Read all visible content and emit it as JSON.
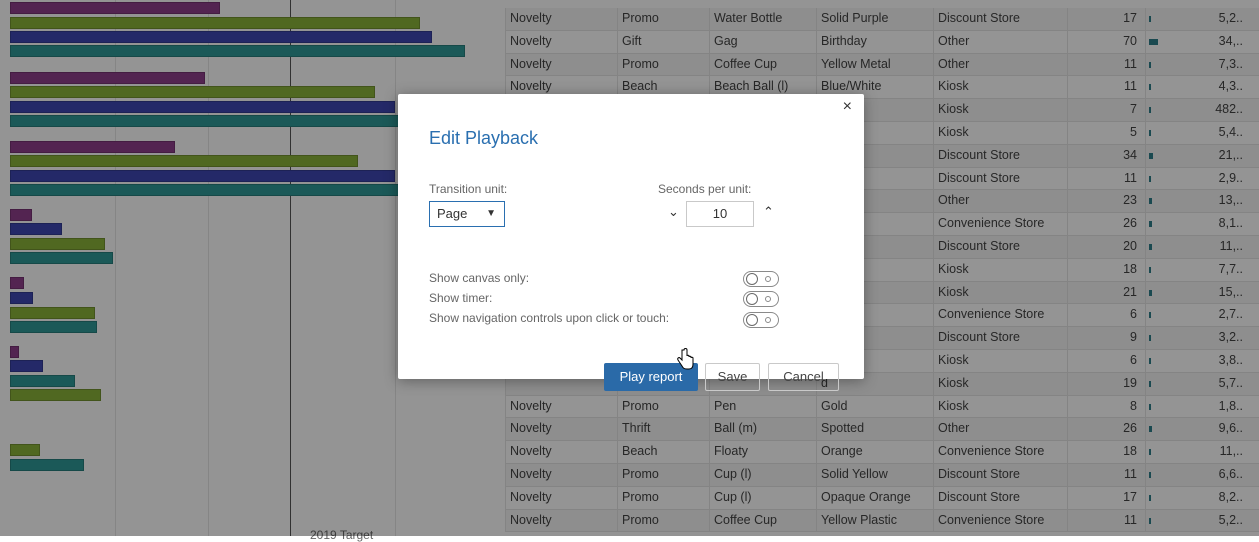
{
  "chart": {
    "caption": "2019 Target",
    "bars": [
      {
        "value": 210,
        "color": "#8f3f8c"
      },
      {
        "value": 410,
        "color": "#8bb33a"
      },
      {
        "value": 422,
        "color": "#3f48b4"
      },
      {
        "value": 455,
        "color": "#2f9a98"
      },
      {
        "value": 195,
        "color": "#8f3f8c"
      },
      {
        "value": 365,
        "color": "#8bb33a"
      },
      {
        "value": 385,
        "color": "#3f48b4"
      },
      {
        "value": 400,
        "color": "#2f9a98"
      },
      {
        "value": 165,
        "color": "#8f3f8c"
      },
      {
        "value": 348,
        "color": "#8bb33a"
      },
      {
        "value": 385,
        "color": "#3f48b4"
      },
      {
        "value": 400,
        "color": "#2f9a98"
      },
      {
        "value": 22,
        "color": "#8f3f8c"
      },
      {
        "value": 52,
        "color": "#3f48b4"
      },
      {
        "value": 95,
        "color": "#8bb33a"
      },
      {
        "value": 103,
        "color": "#2f9a98"
      },
      {
        "value": 14,
        "color": "#8f3f8c"
      },
      {
        "value": 23,
        "color": "#3f48b4"
      },
      {
        "value": 85,
        "color": "#8bb33a"
      },
      {
        "value": 87,
        "color": "#2f9a98"
      },
      {
        "value": 9,
        "color": "#8f3f8c"
      },
      {
        "value": 33,
        "color": "#3f48b4"
      },
      {
        "value": 65,
        "color": "#2f9a98"
      },
      {
        "value": 91,
        "color": "#8bb33a"
      },
      {
        "value": 30,
        "color": "#8bb33a"
      },
      {
        "value": 74,
        "color": "#2f9a98"
      }
    ]
  },
  "table": {
    "rows": [
      {
        "cat": "Novelty",
        "sub": "Promo",
        "prod": "Water Bottle",
        "style": "Solid Purple",
        "chan": "Discount Store",
        "qty": "17",
        "sales": "5,2..",
        "spark": 17
      },
      {
        "cat": "Novelty",
        "sub": "Gift",
        "prod": "Gag",
        "style": "Birthday",
        "chan": "Other",
        "qty": "70",
        "sales": "34,..",
        "spark": 70
      },
      {
        "cat": "Novelty",
        "sub": "Promo",
        "prod": "Coffee Cup",
        "style": "Yellow Metal",
        "chan": "Other",
        "qty": "11",
        "sales": "7,3..",
        "spark": 11
      },
      {
        "cat": "Novelty",
        "sub": "Beach",
        "prod": "Beach Ball (l)",
        "style": "Blue/White",
        "chan": "Kiosk",
        "qty": "11",
        "sales": "4,3..",
        "spark": 11
      },
      {
        "cat": "",
        "sub": "",
        "prod": "",
        "style": "e",
        "chan": "Kiosk",
        "qty": "7",
        "sales": "482..",
        "spark": 7
      },
      {
        "cat": "",
        "sub": "",
        "prod": "",
        "style": "urple",
        "chan": "Kiosk",
        "qty": "5",
        "sales": "5,4..",
        "spark": 5
      },
      {
        "cat": "",
        "sub": "",
        "prod": "",
        "style": "",
        "chan": "Discount Store",
        "qty": "34",
        "sales": "21,..",
        "spark": 34
      },
      {
        "cat": "",
        "sub": "",
        "prod": "",
        "style": "Green",
        "chan": "Discount Store",
        "qty": "11",
        "sales": "2,9..",
        "spark": 11
      },
      {
        "cat": "",
        "sub": "",
        "prod": "",
        "style": "6",
        "chan": "Other",
        "qty": "23",
        "sales": "13,..",
        "spark": 23
      },
      {
        "cat": "",
        "sub": "",
        "prod": "",
        "style": "",
        "chan": "Convenience Store",
        "qty": "26",
        "sales": "8,1..",
        "spark": 26
      },
      {
        "cat": "",
        "sub": "",
        "prod": "",
        "style": "e",
        "chan": "Discount Store",
        "qty": "20",
        "sales": "11,..",
        "spark": 20
      },
      {
        "cat": "",
        "sub": "",
        "prod": "",
        "style": "e",
        "chan": "Kiosk",
        "qty": "18",
        "sales": "7,7..",
        "spark": 18
      },
      {
        "cat": "",
        "sub": "",
        "prod": "",
        "style": "Mixed",
        "chan": "Kiosk",
        "qty": "21",
        "sales": "15,..",
        "spark": 21
      },
      {
        "cat": "",
        "sub": "",
        "prod": "",
        "style": "Clear",
        "chan": "Convenience Store",
        "qty": "6",
        "sales": "2,7..",
        "spark": 6
      },
      {
        "cat": "",
        "sub": "",
        "prod": "",
        "style": "e Blue",
        "chan": "Discount Store",
        "qty": "9",
        "sales": "3,2..",
        "spark": 9
      },
      {
        "cat": "",
        "sub": "",
        "prod": "",
        "style": "e Nylon",
        "chan": "Kiosk",
        "qty": "6",
        "sales": "3,8..",
        "spark": 6
      },
      {
        "cat": "",
        "sub": "",
        "prod": "",
        "style": "d",
        "chan": "Kiosk",
        "qty": "19",
        "sales": "5,7..",
        "spark": 19
      },
      {
        "cat": "Novelty",
        "sub": "Promo",
        "prod": "Pen",
        "style": "Gold",
        "chan": "Kiosk",
        "qty": "8",
        "sales": "1,8..",
        "spark": 8
      },
      {
        "cat": "Novelty",
        "sub": "Thrift",
        "prod": "Ball (m)",
        "style": "Spotted",
        "chan": "Other",
        "qty": "26",
        "sales": "9,6..",
        "spark": 26
      },
      {
        "cat": "Novelty",
        "sub": "Beach",
        "prod": "Floaty",
        "style": "Orange",
        "chan": "Convenience Store",
        "qty": "18",
        "sales": "11,..",
        "spark": 18
      },
      {
        "cat": "Novelty",
        "sub": "Promo",
        "prod": "Cup (l)",
        "style": "Solid Yellow",
        "chan": "Discount Store",
        "qty": "11",
        "sales": "6,6..",
        "spark": 11
      },
      {
        "cat": "Novelty",
        "sub": "Promo",
        "prod": "Cup (l)",
        "style": "Opaque Orange",
        "chan": "Discount Store",
        "qty": "17",
        "sales": "8,2..",
        "spark": 17
      },
      {
        "cat": "Novelty",
        "sub": "Promo",
        "prod": "Coffee Cup",
        "style": "Yellow Plastic",
        "chan": "Convenience Store",
        "qty": "11",
        "sales": "5,2..",
        "spark": 11
      }
    ]
  },
  "dialog": {
    "title": "Edit Playback",
    "close_label": "×",
    "transition_unit_label": "Transition unit:",
    "transition_unit_value": "Page",
    "seconds_label": "Seconds per unit:",
    "seconds_value": "10",
    "toggles": [
      {
        "label": "Show canvas only:",
        "on": false
      },
      {
        "label": "Show timer:",
        "on": false
      },
      {
        "label": "Show navigation controls upon click or touch:",
        "on": false
      }
    ],
    "play_label": "Play report",
    "save_label": "Save",
    "cancel_label": "Cancel",
    "accent_color": "#2a6aa8"
  }
}
